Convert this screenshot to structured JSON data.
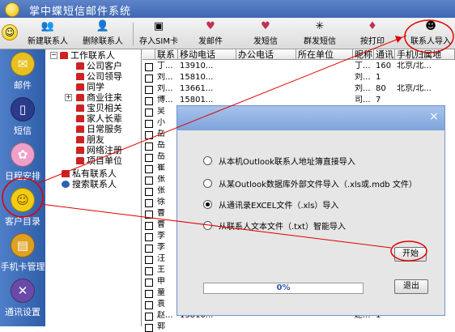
{
  "app": {
    "title": "掌中蝶短信邮件系统"
  },
  "toolbar": {
    "items": [
      {
        "label": "新建联系人",
        "icon": "new-contact-icon"
      },
      {
        "label": "删除联系人",
        "icon": "delete-contact-icon"
      },
      {
        "label": "存入SIM卡",
        "icon": "save-to-sim-icon"
      },
      {
        "label": "发邮件",
        "icon": "send-mail-icon"
      },
      {
        "label": "发短信",
        "icon": "send-sms-icon"
      },
      {
        "label": "群发短信",
        "icon": "bulk-sms-icon"
      },
      {
        "label": "按打印",
        "icon": "print-icon"
      },
      {
        "label": "联系人导入",
        "icon": "import-contacts-icon"
      }
    ]
  },
  "nav": {
    "items": [
      {
        "label": "邮件",
        "color": "#e8c020",
        "glyph": "✉"
      },
      {
        "label": "短信",
        "color": "#2c3a8c",
        "glyph": "▯"
      },
      {
        "label": "日程安排",
        "color": "#f0a0c8",
        "glyph": "✿"
      },
      {
        "label": "客户目录",
        "color": "#f2cc10",
        "glyph": "☺"
      },
      {
        "label": "手机卡管理",
        "color": "#e0a020",
        "glyph": "▤"
      },
      {
        "label": "通讯设置",
        "color": "#6a4aa8",
        "glyph": "✕"
      }
    ]
  },
  "tree": {
    "root": "工作联系人",
    "children": [
      "公司客户",
      "公司领导",
      "同学",
      "商业往来",
      "宝贝相关",
      "家人长辈",
      "日常服务",
      "朋友",
      "网络注册",
      "项目单位"
    ],
    "private": "私有联系人",
    "search": "搜索联系人"
  },
  "grid": {
    "columns": [
      "联系",
      "移动电话",
      "办公电话",
      "所在单位",
      "昵称",
      "通讯",
      "手机归属地"
    ],
    "rows": [
      {
        "name": "丁...",
        "mobile": "13910...",
        "nick": "丁...",
        "comm": "160",
        "loc": "北京/北..."
      },
      {
        "name": "刘...",
        "mobile": "15810...",
        "nick": "刘...",
        "comm": "1",
        "loc": ""
      },
      {
        "name": "刘...",
        "mobile": "13661...",
        "nick": "刘...",
        "comm": "80",
        "loc": "北京/北..."
      },
      {
        "name": "博...",
        "mobile": "15801...",
        "nick": "司...",
        "comm": "7",
        "loc": ""
      },
      {
        "name": "吴",
        "mobile": "",
        "nick": "",
        "comm": "",
        "loc": ""
      },
      {
        "name": "小",
        "mobile": "",
        "nick": "",
        "comm": "",
        "loc": ""
      },
      {
        "name": "岳",
        "mobile": "",
        "nick": "",
        "comm": "",
        "loc": ""
      },
      {
        "name": "岳",
        "mobile": "",
        "nick": "",
        "comm": "",
        "loc": ""
      },
      {
        "name": "岳",
        "mobile": "",
        "nick": "",
        "comm": "",
        "loc": ""
      },
      {
        "name": "崔",
        "mobile": "",
        "nick": "",
        "comm": "",
        "loc": ""
      },
      {
        "name": "张",
        "mobile": "",
        "nick": "",
        "comm": "",
        "loc": ""
      },
      {
        "name": "张",
        "mobile": "",
        "nick": "",
        "comm": "",
        "loc": ""
      },
      {
        "name": "徐",
        "mobile": "",
        "nick": "",
        "comm": "",
        "loc": ""
      },
      {
        "name": "曹",
        "mobile": "",
        "nick": "",
        "comm": "",
        "loc": ""
      },
      {
        "name": "曹",
        "mobile": "",
        "nick": "",
        "comm": "",
        "loc": ""
      },
      {
        "name": "李",
        "mobile": "",
        "nick": "",
        "comm": "",
        "loc": ""
      },
      {
        "name": "李",
        "mobile": "",
        "nick": "",
        "comm": "",
        "loc": ""
      },
      {
        "name": "汪",
        "mobile": "",
        "nick": "",
        "comm": "",
        "loc": ""
      },
      {
        "name": "王",
        "mobile": "",
        "nick": "",
        "comm": "",
        "loc": ""
      },
      {
        "name": "申",
        "mobile": "",
        "nick": "",
        "comm": "",
        "loc": ""
      },
      {
        "name": "童",
        "mobile": "",
        "nick": "",
        "comm": "",
        "loc": ""
      },
      {
        "name": "袁",
        "mobile": "",
        "nick": "",
        "comm": "",
        "loc": ""
      },
      {
        "name": "赵...",
        "mobile": "13810...",
        "nick": "赵...",
        "comm": "1",
        "loc": ""
      },
      {
        "name": "郭",
        "mobile": "",
        "nick": "",
        "comm": "",
        "loc": ""
      }
    ]
  },
  "dialog": {
    "close": "×",
    "options": [
      "从本机Outlook联系人地址簿直接导入",
      "从某Outlook数据库外部文件导入（.xls或.mdb 文件）",
      "从通讯录EXCEL文件（.xls）导入",
      "从联系人文本文件（.txt）智能导入"
    ],
    "selected_option": 2,
    "start_label": "开始",
    "exit_label": "退出",
    "progress_text": "0%",
    "progress_value": 0
  },
  "colors": {
    "accent": "#3f68b3",
    "annotation": "#e00000",
    "nav": "#2f5ea9"
  }
}
